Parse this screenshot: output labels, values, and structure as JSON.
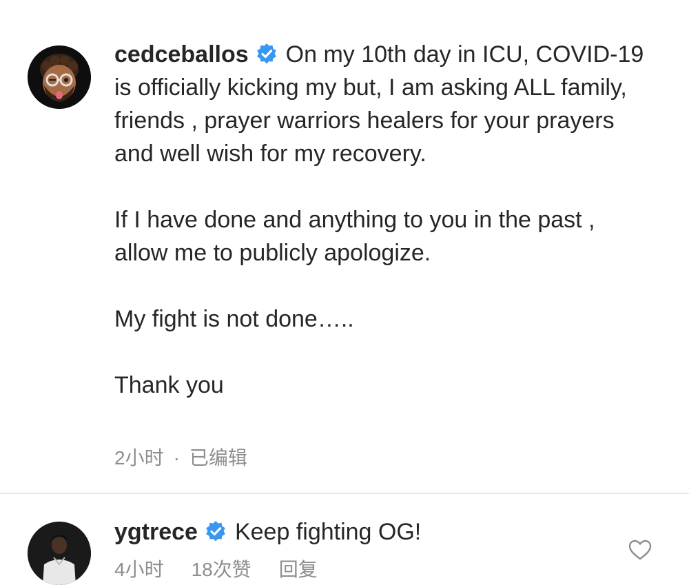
{
  "caption": {
    "username": "cedceballos",
    "paragraphs": [
      "On my 10th day in ICU, COVID-19 is officially kicking my but, I am asking ALL family, friends , prayer warriors healers for your prayers and well wish for my recovery.",
      "If I have done and anything to you in the past , allow me to publicly apologize.",
      "My fight is not done…..",
      "Thank you"
    ],
    "time": "2小时",
    "separator": "·",
    "edited": "已编辑"
  },
  "comment": {
    "username": "ygtrece",
    "text": "Keep fighting OG!",
    "time": "4小时",
    "likes": "18次赞",
    "reply": "回复"
  },
  "colors": {
    "verified_blue": "#3897f0",
    "meta_gray": "#8e8e8e"
  },
  "icons": {
    "verified": "verified-badge-icon",
    "like": "heart-outline-icon"
  }
}
